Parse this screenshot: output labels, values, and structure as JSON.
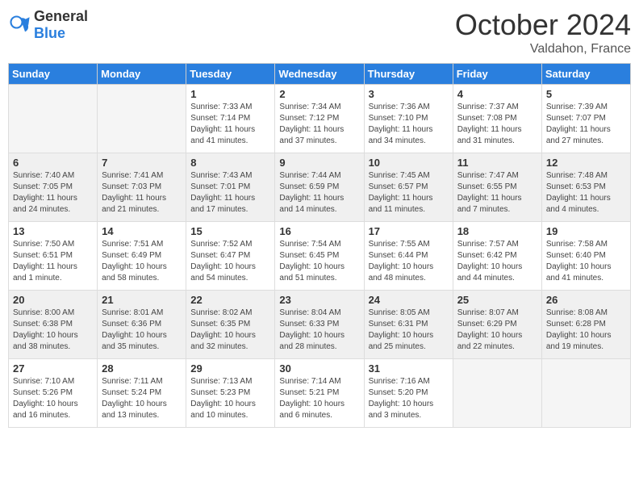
{
  "header": {
    "logo_general": "General",
    "logo_blue": "Blue",
    "month": "October 2024",
    "location": "Valdahon, France"
  },
  "days_of_week": [
    "Sunday",
    "Monday",
    "Tuesday",
    "Wednesday",
    "Thursday",
    "Friday",
    "Saturday"
  ],
  "weeks": [
    [
      {
        "day": "",
        "empty": true
      },
      {
        "day": "",
        "empty": true
      },
      {
        "day": "1",
        "sunrise": "Sunrise: 7:33 AM",
        "sunset": "Sunset: 7:14 PM",
        "daylight": "Daylight: 11 hours and 41 minutes."
      },
      {
        "day": "2",
        "sunrise": "Sunrise: 7:34 AM",
        "sunset": "Sunset: 7:12 PM",
        "daylight": "Daylight: 11 hours and 37 minutes."
      },
      {
        "day": "3",
        "sunrise": "Sunrise: 7:36 AM",
        "sunset": "Sunset: 7:10 PM",
        "daylight": "Daylight: 11 hours and 34 minutes."
      },
      {
        "day": "4",
        "sunrise": "Sunrise: 7:37 AM",
        "sunset": "Sunset: 7:08 PM",
        "daylight": "Daylight: 11 hours and 31 minutes."
      },
      {
        "day": "5",
        "sunrise": "Sunrise: 7:39 AM",
        "sunset": "Sunset: 7:07 PM",
        "daylight": "Daylight: 11 hours and 27 minutes."
      }
    ],
    [
      {
        "day": "6",
        "sunrise": "Sunrise: 7:40 AM",
        "sunset": "Sunset: 7:05 PM",
        "daylight": "Daylight: 11 hours and 24 minutes."
      },
      {
        "day": "7",
        "sunrise": "Sunrise: 7:41 AM",
        "sunset": "Sunset: 7:03 PM",
        "daylight": "Daylight: 11 hours and 21 minutes."
      },
      {
        "day": "8",
        "sunrise": "Sunrise: 7:43 AM",
        "sunset": "Sunset: 7:01 PM",
        "daylight": "Daylight: 11 hours and 17 minutes."
      },
      {
        "day": "9",
        "sunrise": "Sunrise: 7:44 AM",
        "sunset": "Sunset: 6:59 PM",
        "daylight": "Daylight: 11 hours and 14 minutes."
      },
      {
        "day": "10",
        "sunrise": "Sunrise: 7:45 AM",
        "sunset": "Sunset: 6:57 PM",
        "daylight": "Daylight: 11 hours and 11 minutes."
      },
      {
        "day": "11",
        "sunrise": "Sunrise: 7:47 AM",
        "sunset": "Sunset: 6:55 PM",
        "daylight": "Daylight: 11 hours and 7 minutes."
      },
      {
        "day": "12",
        "sunrise": "Sunrise: 7:48 AM",
        "sunset": "Sunset: 6:53 PM",
        "daylight": "Daylight: 11 hours and 4 minutes."
      }
    ],
    [
      {
        "day": "13",
        "sunrise": "Sunrise: 7:50 AM",
        "sunset": "Sunset: 6:51 PM",
        "daylight": "Daylight: 11 hours and 1 minute."
      },
      {
        "day": "14",
        "sunrise": "Sunrise: 7:51 AM",
        "sunset": "Sunset: 6:49 PM",
        "daylight": "Daylight: 10 hours and 58 minutes."
      },
      {
        "day": "15",
        "sunrise": "Sunrise: 7:52 AM",
        "sunset": "Sunset: 6:47 PM",
        "daylight": "Daylight: 10 hours and 54 minutes."
      },
      {
        "day": "16",
        "sunrise": "Sunrise: 7:54 AM",
        "sunset": "Sunset: 6:45 PM",
        "daylight": "Daylight: 10 hours and 51 minutes."
      },
      {
        "day": "17",
        "sunrise": "Sunrise: 7:55 AM",
        "sunset": "Sunset: 6:44 PM",
        "daylight": "Daylight: 10 hours and 48 minutes."
      },
      {
        "day": "18",
        "sunrise": "Sunrise: 7:57 AM",
        "sunset": "Sunset: 6:42 PM",
        "daylight": "Daylight: 10 hours and 44 minutes."
      },
      {
        "day": "19",
        "sunrise": "Sunrise: 7:58 AM",
        "sunset": "Sunset: 6:40 PM",
        "daylight": "Daylight: 10 hours and 41 minutes."
      }
    ],
    [
      {
        "day": "20",
        "sunrise": "Sunrise: 8:00 AM",
        "sunset": "Sunset: 6:38 PM",
        "daylight": "Daylight: 10 hours and 38 minutes."
      },
      {
        "day": "21",
        "sunrise": "Sunrise: 8:01 AM",
        "sunset": "Sunset: 6:36 PM",
        "daylight": "Daylight: 10 hours and 35 minutes."
      },
      {
        "day": "22",
        "sunrise": "Sunrise: 8:02 AM",
        "sunset": "Sunset: 6:35 PM",
        "daylight": "Daylight: 10 hours and 32 minutes."
      },
      {
        "day": "23",
        "sunrise": "Sunrise: 8:04 AM",
        "sunset": "Sunset: 6:33 PM",
        "daylight": "Daylight: 10 hours and 28 minutes."
      },
      {
        "day": "24",
        "sunrise": "Sunrise: 8:05 AM",
        "sunset": "Sunset: 6:31 PM",
        "daylight": "Daylight: 10 hours and 25 minutes."
      },
      {
        "day": "25",
        "sunrise": "Sunrise: 8:07 AM",
        "sunset": "Sunset: 6:29 PM",
        "daylight": "Daylight: 10 hours and 22 minutes."
      },
      {
        "day": "26",
        "sunrise": "Sunrise: 8:08 AM",
        "sunset": "Sunset: 6:28 PM",
        "daylight": "Daylight: 10 hours and 19 minutes."
      }
    ],
    [
      {
        "day": "27",
        "sunrise": "Sunrise: 7:10 AM",
        "sunset": "Sunset: 5:26 PM",
        "daylight": "Daylight: 10 hours and 16 minutes."
      },
      {
        "day": "28",
        "sunrise": "Sunrise: 7:11 AM",
        "sunset": "Sunset: 5:24 PM",
        "daylight": "Daylight: 10 hours and 13 minutes."
      },
      {
        "day": "29",
        "sunrise": "Sunrise: 7:13 AM",
        "sunset": "Sunset: 5:23 PM",
        "daylight": "Daylight: 10 hours and 10 minutes."
      },
      {
        "day": "30",
        "sunrise": "Sunrise: 7:14 AM",
        "sunset": "Sunset: 5:21 PM",
        "daylight": "Daylight: 10 hours and 6 minutes."
      },
      {
        "day": "31",
        "sunrise": "Sunrise: 7:16 AM",
        "sunset": "Sunset: 5:20 PM",
        "daylight": "Daylight: 10 hours and 3 minutes."
      },
      {
        "day": "",
        "empty": true
      },
      {
        "day": "",
        "empty": true
      }
    ]
  ]
}
